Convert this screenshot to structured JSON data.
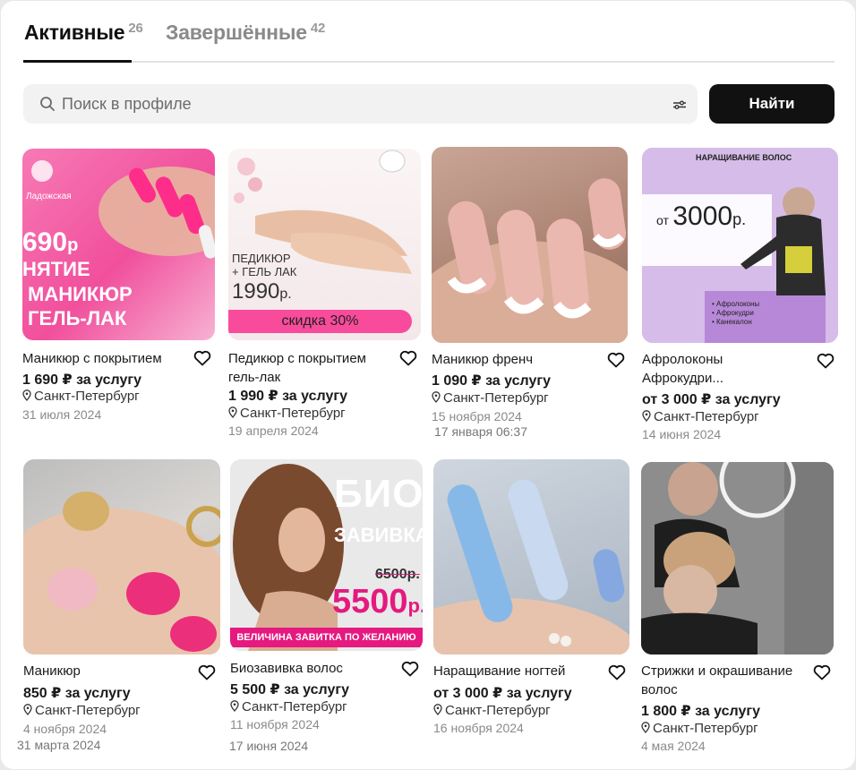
{
  "tabs": [
    {
      "label": "Активные",
      "count": "26"
    },
    {
      "label": "Завершённые",
      "count": "42"
    }
  ],
  "search": {
    "placeholder": "Поиск в профиле",
    "button_label": "Найти"
  },
  "listings": [
    {
      "title": "Маникюр с покрытием",
      "price": "1 690 ₽ за услугу",
      "city": "Санкт-Петербург",
      "date": "31 июля 2024",
      "image_text": {
        "brand": "Ладожская",
        "price": "690",
        "currency": "р",
        "line1": "НЯТИЕ",
        "line2": "МАНИКЮР",
        "line3": "ГЕЛЬ-ЛАК"
      }
    },
    {
      "title": "Педикюр с покрытием гель-лак",
      "price": "1 990 ₽ за услугу",
      "city": "Санкт-Петербург",
      "date": "19 апреля 2024",
      "image_text": {
        "line1": "ПЕДИКЮР",
        "line2": "+ ГЕЛЬ ЛАК",
        "price": "1990",
        "currency": "р.",
        "discount": "скидка 30%"
      }
    },
    {
      "title": "Маникюр френч",
      "price": "1 090 ₽ за услугу",
      "city": "Санкт-Петербург",
      "date": "15 ноября 2024",
      "date_extra": "17 января 06:37"
    },
    {
      "title": "Афролоконы Афрокудри...",
      "price": "от 3 000 ₽ за услугу",
      "city": "Санкт-Петербург",
      "date": "14 июня 2024",
      "image_text": {
        "header": "НАРАЩИВАНИЕ ВОЛОС",
        "from": "от",
        "price": "3000",
        "currency": "р.",
        "bullets": [
          "• Афролоконы",
          "• Афрокудри",
          "• Канекалон"
        ]
      }
    },
    {
      "title": "Маникюр",
      "price": "850 ₽ за услугу",
      "city": "Санкт-Петербург",
      "date": "4 ноября 2024",
      "date_extra": "31 марта 2024"
    },
    {
      "title": "Биозавивка волос",
      "price": "5 500 ₽ за услугу",
      "city": "Санкт-Петербург",
      "date": "11 ноября 2024",
      "date_extra": "17 июня 2024",
      "image_text": {
        "line1": "БИО",
        "line2": "ЗАВИВКА",
        "old_price": "6500р.",
        "price": "5500",
        "currency": "р.",
        "banner": "ВЕЛИЧИНА ЗАВИТКА ПО ЖЕЛАНИЮ"
      }
    },
    {
      "title": "Наращивание ногтей",
      "price": "от 3 000 ₽ за услугу",
      "city": "Санкт-Петербург",
      "date": "16 ноября 2024"
    },
    {
      "title": "Стрижки и окрашивание волос",
      "price": "1 800 ₽ за услугу",
      "city": "Санкт-Петербург",
      "date": "4 мая 2024"
    }
  ],
  "colors": {
    "accent_dark": "#111111",
    "pink": "#f0569a",
    "lavender": "#c9a6e0",
    "muted": "#8a8a8a"
  }
}
